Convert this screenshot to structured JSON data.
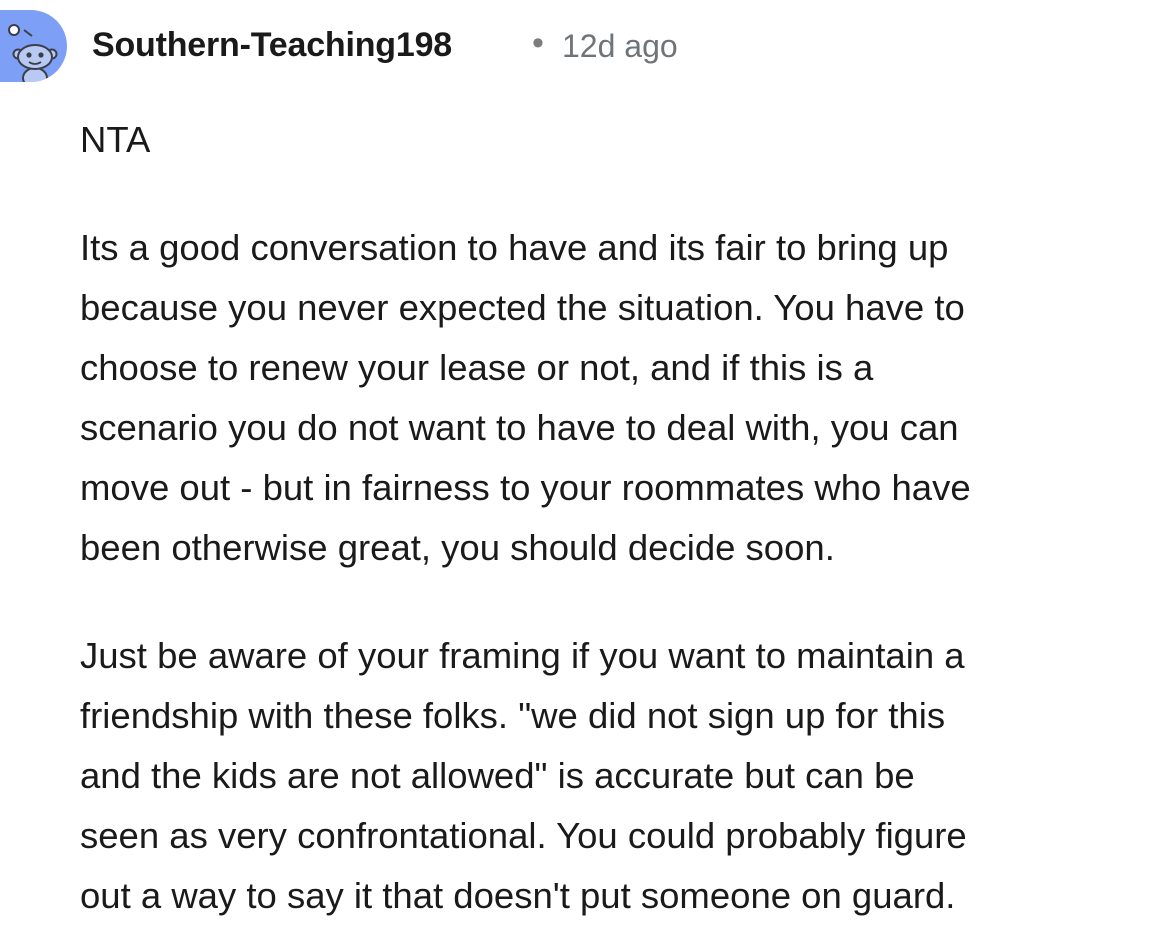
{
  "comment": {
    "author": "Southern-Teaching198",
    "separator": "•",
    "timestamp": "12d ago",
    "avatar_icon": "reddit-snoo-avatar-icon",
    "avatar_color": "#7d9ff5",
    "paragraphs": [
      {
        "lines": [
          "NTA"
        ]
      },
      {
        "lines": [
          "Its a good conversation to have and its fair to bring up",
          "because you never expected the situation. You have to",
          "choose to renew your lease or not, and if this is a",
          "scenario you do not want to have to deal with, you can",
          "move out - but in fairness to your roommates who have",
          "been otherwise great, you should decide soon."
        ]
      },
      {
        "lines": [
          "Just be aware of your framing if you want to maintain a",
          "friendship with these folks. \"we did not sign up for this",
          "and the kids are not allowed\" is accurate but can be",
          "seen as very confrontational. You could probably figure",
          "out a way to say it that doesn't put someone on guard."
        ]
      }
    ]
  }
}
